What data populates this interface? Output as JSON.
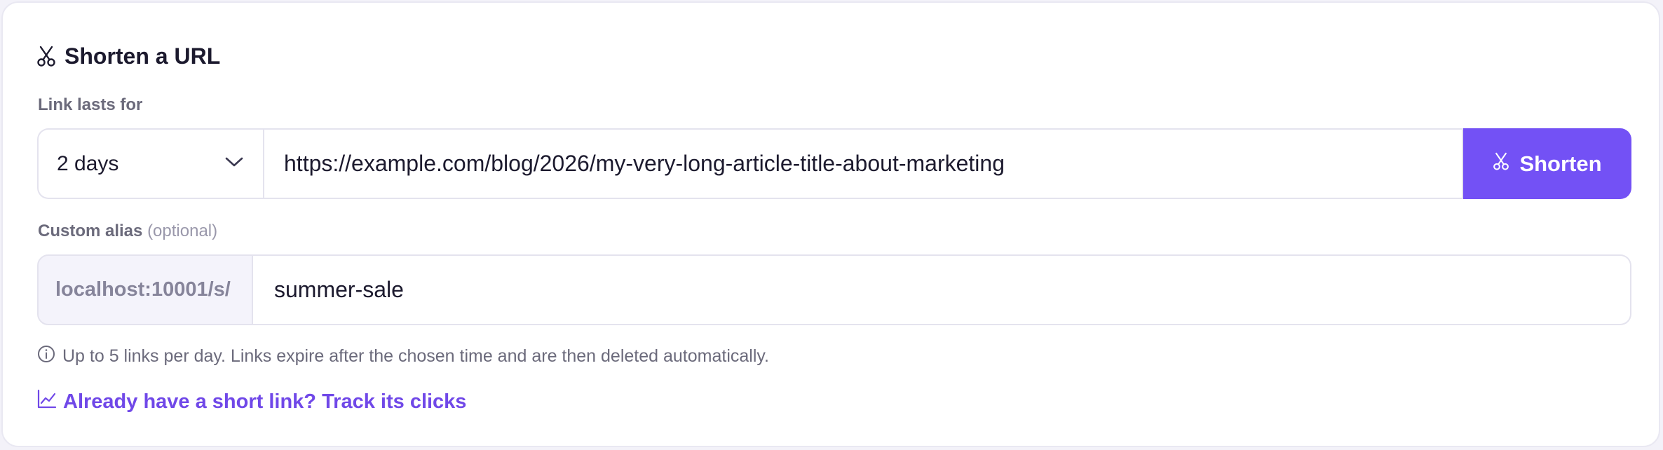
{
  "header": {
    "title": "Shorten a URL",
    "icon": "scissors-icon"
  },
  "duration": {
    "label": "Link lasts for",
    "selected": "2 days"
  },
  "url_input": {
    "value": "https://example.com/blog/2026/my-very-long-article-title-about-marketing"
  },
  "shorten_button": {
    "label": "Shorten",
    "icon": "scissors-icon"
  },
  "alias": {
    "label": "Custom alias",
    "optional": "(optional)",
    "prefix": "localhost:10001/s/",
    "value": "summer-sale"
  },
  "info": {
    "icon": "info-icon",
    "text": "Up to 5 links per day. Links expire after the chosen time and are then deleted automatically."
  },
  "track_link": {
    "icon": "chart-line-icon",
    "label": "Already have a short link? Track its clicks"
  },
  "colors": {
    "accent": "#7351f5",
    "link": "#7048e8",
    "text": "#1c1a2e",
    "muted": "#6b6a7b",
    "border": "#e4e3ee",
    "prefix_bg": "#f4f3fb"
  }
}
